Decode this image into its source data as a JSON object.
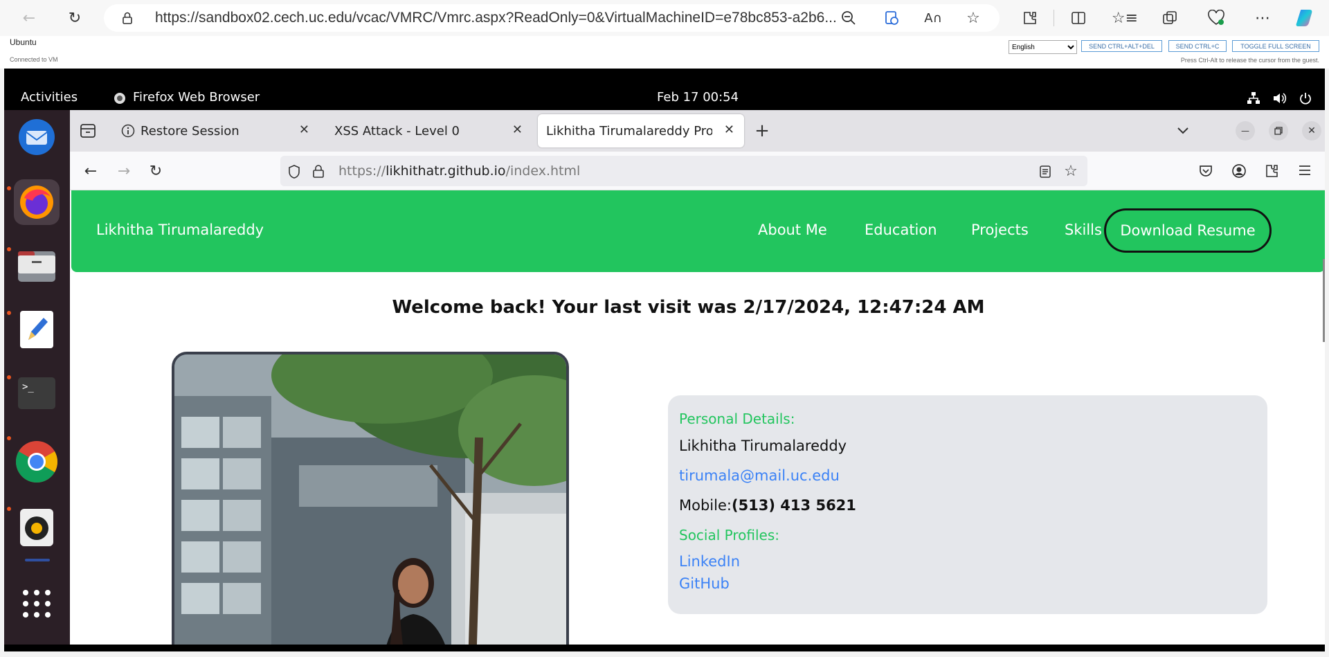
{
  "edge": {
    "url": "https://sandbox02.cech.uc.edu/vcac/VMRC/Vmrc.aspx?ReadOnly=0&VirtualMachineID=e78bc853-a2b6..."
  },
  "vmrc": {
    "title": "Ubuntu",
    "status": "Connected to VM",
    "language": "English",
    "btn_cad": "SEND CTRL+ALT+DEL",
    "btn_ctrlc": "SEND CTRL+C",
    "btn_fullscreen": "TOGGLE FULL SCREEN",
    "hint": "Press Ctrl-Alt to release the cursor from the guest."
  },
  "gnome": {
    "activities": "Activities",
    "app_name": "Firefox Web Browser",
    "clock": "Feb 17  00:54"
  },
  "firefox": {
    "tabs": [
      {
        "label": "Restore Session"
      },
      {
        "label": "XSS Attack - Level 0"
      },
      {
        "label": "Likhitha Tirumalareddy Profile"
      }
    ],
    "url_prefix": "https://",
    "url_host": "likhithatr.github.io",
    "url_path": "/index.html"
  },
  "site": {
    "brand": "Likhitha Tirumalareddy",
    "nav": [
      "About Me",
      "Education",
      "Projects",
      "Skills"
    ],
    "resume": "Download Resume",
    "welcome": "Welcome back! Your last visit was 2/17/2024, 12:47:24 AM",
    "personal_heading": "Personal Details:",
    "name": "Likhitha Tirumalareddy",
    "email": "tirumala@mail.uc.edu",
    "mobile_label": "Mobile:",
    "mobile_value": "(513) 413 5621",
    "social_heading": "Social Profiles:",
    "linkedin": "LinkedIn",
    "github": "GitHub"
  },
  "colors": {
    "nav_green": "#22c55e",
    "link_blue": "#3b82f6",
    "card_gray": "#e5e7eb"
  }
}
